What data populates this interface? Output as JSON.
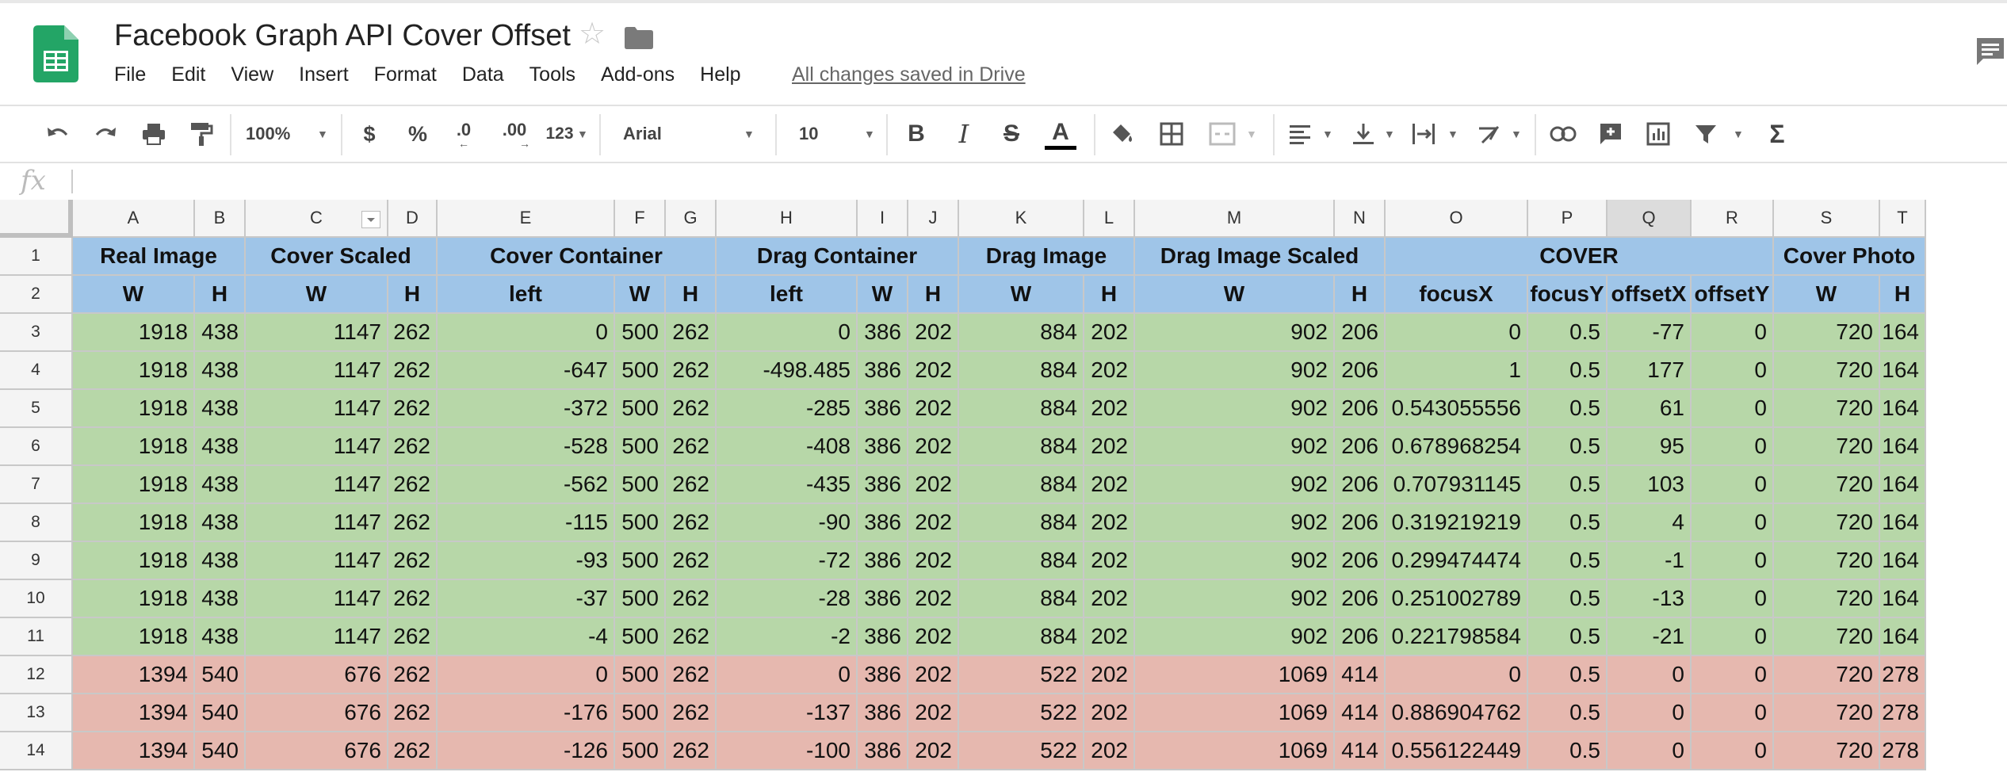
{
  "document": {
    "title": "Facebook Graph API Cover Offset",
    "save_status": "All changes saved in Drive"
  },
  "menu": [
    "File",
    "Edit",
    "View",
    "Insert",
    "Format",
    "Data",
    "Tools",
    "Add-ons",
    "Help"
  ],
  "toolbar": {
    "zoom": "100%",
    "currency": "$",
    "percent": "%",
    "decrease_decimal": ".0",
    "increase_decimal": ".00",
    "more_formats": "123",
    "font": "Arial",
    "font_size": "10",
    "bold": "B",
    "italic": "I",
    "strike": "S",
    "text_color": "A",
    "text_color_value": "#000000",
    "sum": "Σ"
  },
  "formula_bar": {
    "label": "fx",
    "value": ""
  },
  "sheet": {
    "column_letters": [
      "A",
      "B",
      "C",
      "D",
      "E",
      "F",
      "G",
      "H",
      "I",
      "J",
      "K",
      "L",
      "M",
      "N",
      "O",
      "P",
      "Q",
      "R",
      "S",
      "T"
    ],
    "selected_column": "Q",
    "row_numbers": [
      "1",
      "2",
      "3",
      "4",
      "5",
      "6",
      "7",
      "8",
      "9",
      "10",
      "11",
      "12",
      "13",
      "14"
    ],
    "group_headers": [
      "Real Image",
      "Cover Scaled",
      "Cover Container",
      "Drag Container",
      "Drag Image",
      "Drag Image Scaled",
      "COVER",
      "Cover Photo"
    ],
    "sub_headers": [
      "W",
      "H",
      "W",
      "H",
      "left",
      "W",
      "H",
      "left",
      "W",
      "H",
      "W",
      "H",
      "W",
      "H",
      "focusX",
      "focusY",
      "offsetX",
      "offsetY",
      "W",
      "H"
    ],
    "rows": [
      {
        "status": "green",
        "cells": [
          "1918",
          "438",
          "1147",
          "262",
          "0",
          "500",
          "262",
          "0",
          "386",
          "202",
          "884",
          "202",
          "902",
          "206",
          "0",
          "0.5",
          "-77",
          "0",
          "720",
          "164"
        ]
      },
      {
        "status": "green",
        "cells": [
          "1918",
          "438",
          "1147",
          "262",
          "-647",
          "500",
          "262",
          "-498.485",
          "386",
          "202",
          "884",
          "202",
          "902",
          "206",
          "1",
          "0.5",
          "177",
          "0",
          "720",
          "164"
        ]
      },
      {
        "status": "green",
        "cells": [
          "1918",
          "438",
          "1147",
          "262",
          "-372",
          "500",
          "262",
          "-285",
          "386",
          "202",
          "884",
          "202",
          "902",
          "206",
          "0.543055556",
          "0.5",
          "61",
          "0",
          "720",
          "164"
        ]
      },
      {
        "status": "green",
        "cells": [
          "1918",
          "438",
          "1147",
          "262",
          "-528",
          "500",
          "262",
          "-408",
          "386",
          "202",
          "884",
          "202",
          "902",
          "206",
          "0.678968254",
          "0.5",
          "95",
          "0",
          "720",
          "164"
        ]
      },
      {
        "status": "green",
        "cells": [
          "1918",
          "438",
          "1147",
          "262",
          "-562",
          "500",
          "262",
          "-435",
          "386",
          "202",
          "884",
          "202",
          "902",
          "206",
          "0.707931145",
          "0.5",
          "103",
          "0",
          "720",
          "164"
        ]
      },
      {
        "status": "green",
        "cells": [
          "1918",
          "438",
          "1147",
          "262",
          "-115",
          "500",
          "262",
          "-90",
          "386",
          "202",
          "884",
          "202",
          "902",
          "206",
          "0.319219219",
          "0.5",
          "4",
          "0",
          "720",
          "164"
        ]
      },
      {
        "status": "green",
        "cells": [
          "1918",
          "438",
          "1147",
          "262",
          "-93",
          "500",
          "262",
          "-72",
          "386",
          "202",
          "884",
          "202",
          "902",
          "206",
          "0.299474474",
          "0.5",
          "-1",
          "0",
          "720",
          "164"
        ]
      },
      {
        "status": "green",
        "cells": [
          "1918",
          "438",
          "1147",
          "262",
          "-37",
          "500",
          "262",
          "-28",
          "386",
          "202",
          "884",
          "202",
          "902",
          "206",
          "0.251002789",
          "0.5",
          "-13",
          "0",
          "720",
          "164"
        ]
      },
      {
        "status": "green",
        "cells": [
          "1918",
          "438",
          "1147",
          "262",
          "-4",
          "500",
          "262",
          "-2",
          "386",
          "202",
          "884",
          "202",
          "902",
          "206",
          "0.221798584",
          "0.5",
          "-21",
          "0",
          "720",
          "164"
        ]
      },
      {
        "status": "red",
        "cells": [
          "1394",
          "540",
          "676",
          "262",
          "0",
          "500",
          "262",
          "0",
          "386",
          "202",
          "522",
          "202",
          "1069",
          "414",
          "0",
          "0.5",
          "0",
          "0",
          "720",
          "278"
        ]
      },
      {
        "status": "red",
        "cells": [
          "1394",
          "540",
          "676",
          "262",
          "-176",
          "500",
          "262",
          "-137",
          "386",
          "202",
          "522",
          "202",
          "1069",
          "414",
          "0.886904762",
          "0.5",
          "0",
          "0",
          "720",
          "278"
        ]
      },
      {
        "status": "red",
        "cells": [
          "1394",
          "540",
          "676",
          "262",
          "-126",
          "500",
          "262",
          "-100",
          "386",
          "202",
          "522",
          "202",
          "1069",
          "414",
          "0.556122449",
          "0.5",
          "0",
          "0",
          "720",
          "278"
        ]
      }
    ]
  },
  "colors": {
    "header_blue": "#9fc5e8",
    "row_green": "#b7d7a8",
    "row_red": "#e6b8af",
    "sheets_logo_green": "#23a566"
  }
}
